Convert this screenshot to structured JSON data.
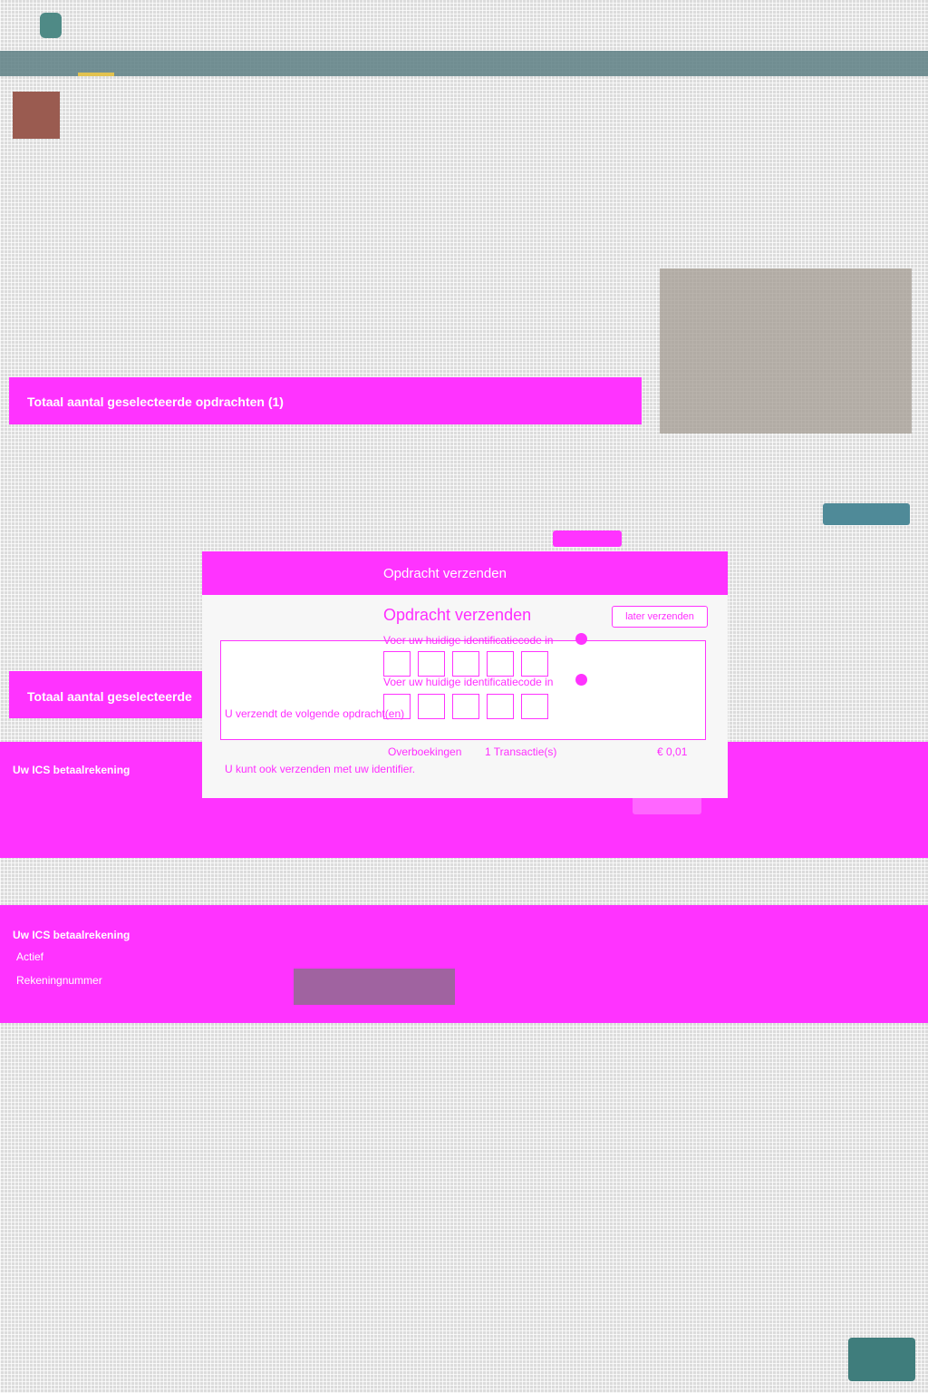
{
  "colors": {
    "accent_magenta": "#ff33ff",
    "nav_teal": "#5d7f84",
    "button_teal": "#4f8a98"
  },
  "header": {
    "logo_icon": "bank-logo-icon"
  },
  "banners": {
    "bar1_title": "Totaal aantal geselecteerde opdrachten (1)",
    "bar2_title": "Totaal aantal geselecteerde",
    "panel1_heading": "Uw ICS betaalrekening",
    "panel2_heading": "Uw ICS betaalrekening",
    "panel2_items": [
      "Actief",
      "Rekeningnummer"
    ]
  },
  "modal": {
    "header_title": "Opdracht verzenden",
    "title": "Opdracht verzenden",
    "later_button": "later verzenden",
    "code_label_1": "Voer uw huidige identificatiecode in",
    "code_label_2": "Voer uw huidige identificatiecode in",
    "sending_text": "U verzendt de volgende opdracht(en)",
    "summary": {
      "type": "Overboekingen",
      "count": "1 Transactie(s)",
      "amount": "€ 0,01"
    },
    "identifier_text": "U kunt ook verzenden met uw identifier."
  }
}
